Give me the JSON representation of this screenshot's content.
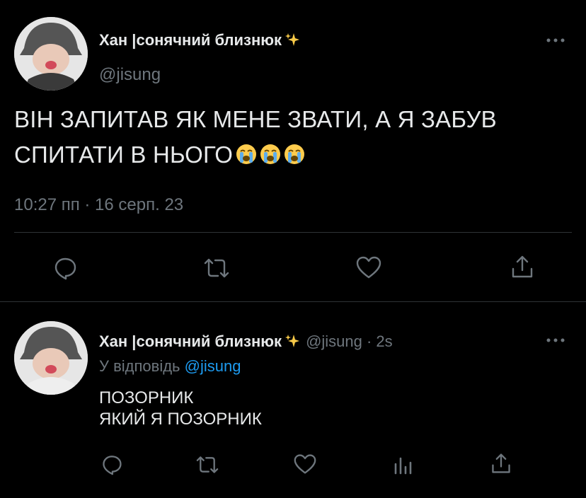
{
  "main_tweet": {
    "display_name": "Хан |сонячний близнюк",
    "handle": "@jisung",
    "text_line1": "ВІН ЗАПИТАВ ЯК МЕНЕ ЗВАТИ, А Я ЗАБУВ",
    "text_line2": "СПИТАТИ В НЬОГО",
    "timestamp": "10:27 пп · 16 серп. 23"
  },
  "reply_tweet": {
    "display_name": "Хан |сонячний близнюк",
    "handle_time": "@jisung · 2s",
    "replying_prefix": "У відповідь",
    "replying_to": "@jisung",
    "text_line1": "ПОЗОРНИК",
    "text_line2": "ЯКИЙ Я ПОЗОРНИК"
  },
  "icons": {
    "sparkles": "sparkles-icon",
    "more": "more-icon",
    "reply": "reply-icon",
    "retweet": "retweet-icon",
    "like": "heart-icon",
    "share": "share-icon",
    "analytics": "analytics-icon",
    "emoji": "loudly-crying-face-emoji"
  },
  "colors": {
    "background": "#000000",
    "text": "#e7e9ea",
    "muted": "#6e767d",
    "link": "#1d9bf0",
    "divider": "#2f3336"
  }
}
